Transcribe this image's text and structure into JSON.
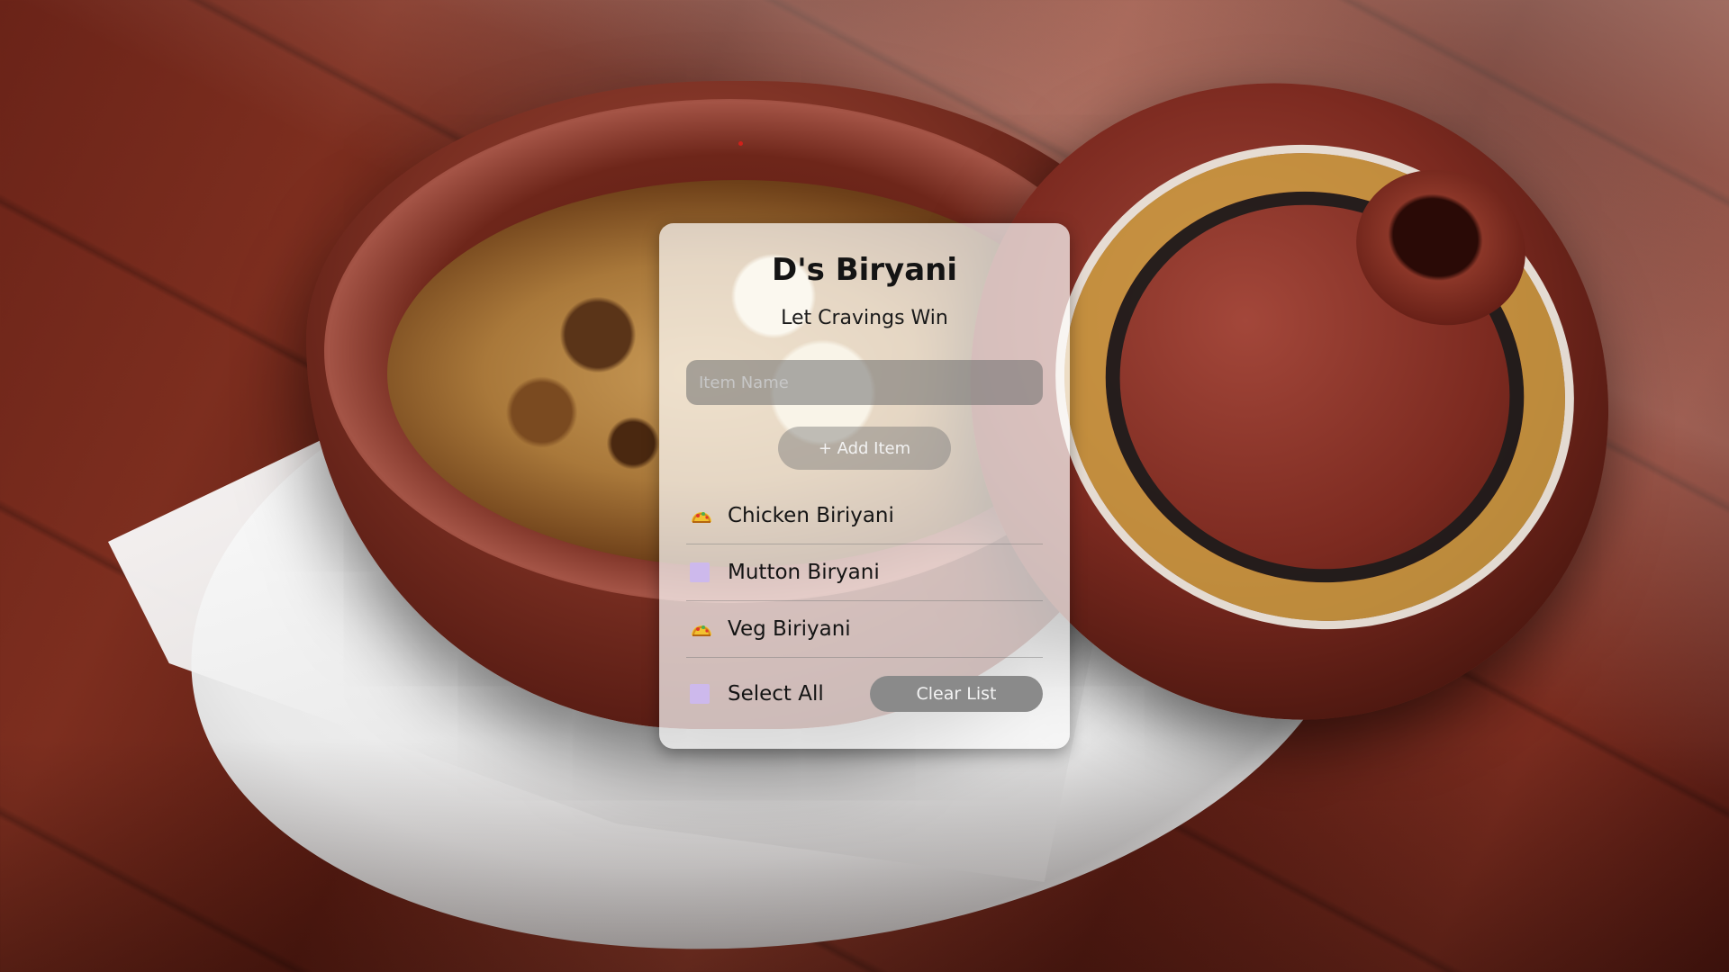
{
  "app": {
    "title": "D's Biryani",
    "subtitle": "Let Cravings Win"
  },
  "form": {
    "input_placeholder": "Item Name",
    "input_value": "",
    "add_button_label": "+ Add Item"
  },
  "items": [
    {
      "label": "Chicken Biriyani",
      "state": "done",
      "icon": "taco-icon"
    },
    {
      "label": "Mutton Biryani",
      "state": "unchecked",
      "icon": "checkbox"
    },
    {
      "label": "Veg Biriyani",
      "state": "done",
      "icon": "taco-icon"
    }
  ],
  "footer": {
    "select_all_label": "Select All",
    "clear_button_label": "Clear List"
  },
  "colors": {
    "checkbox": "#cdb9ec",
    "clear_button": "#8a8a8a",
    "card_background": "rgba(255,255,255,0.70)"
  }
}
